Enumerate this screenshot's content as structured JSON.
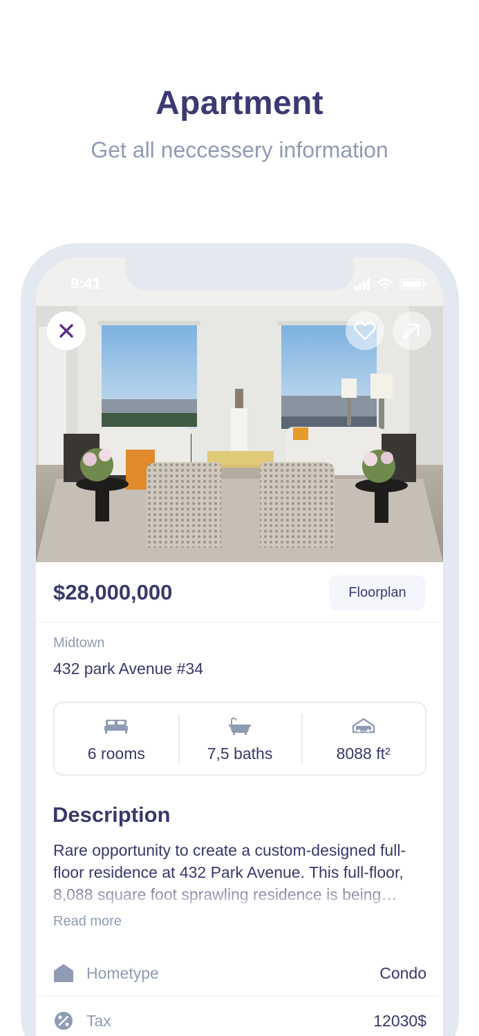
{
  "promo": {
    "title": "Apartment",
    "subtitle": "Get all neccessery information"
  },
  "status_bar": {
    "time": "9:41"
  },
  "listing": {
    "price": "$28,000,000",
    "floorplan_label": "Floorplan",
    "area": "Midtown",
    "address": "432 park Avenue #34",
    "stats": [
      {
        "icon": "bed-icon",
        "label": "6 rooms"
      },
      {
        "icon": "bathtub-icon",
        "label": "7,5 baths"
      },
      {
        "icon": "car-icon",
        "label": "8088 ft²"
      }
    ]
  },
  "description": {
    "title": "Description",
    "text": "Rare opportunity to create a custom-designed full-floor residence at 432 Park Avenue. This full-floor, 8,088 square foot sprawling residence is being…",
    "read_more": "Read more"
  },
  "details": [
    {
      "icon": "house-icon",
      "label": "Hometype",
      "value": "Condo"
    },
    {
      "icon": "percent-icon",
      "label": "Tax",
      "value": "12030$"
    }
  ],
  "colors": {
    "accent": "#3b3a72",
    "muted": "#8f9bb3",
    "close_icon": "#5b2a86",
    "frame": "#e4e9f1"
  }
}
